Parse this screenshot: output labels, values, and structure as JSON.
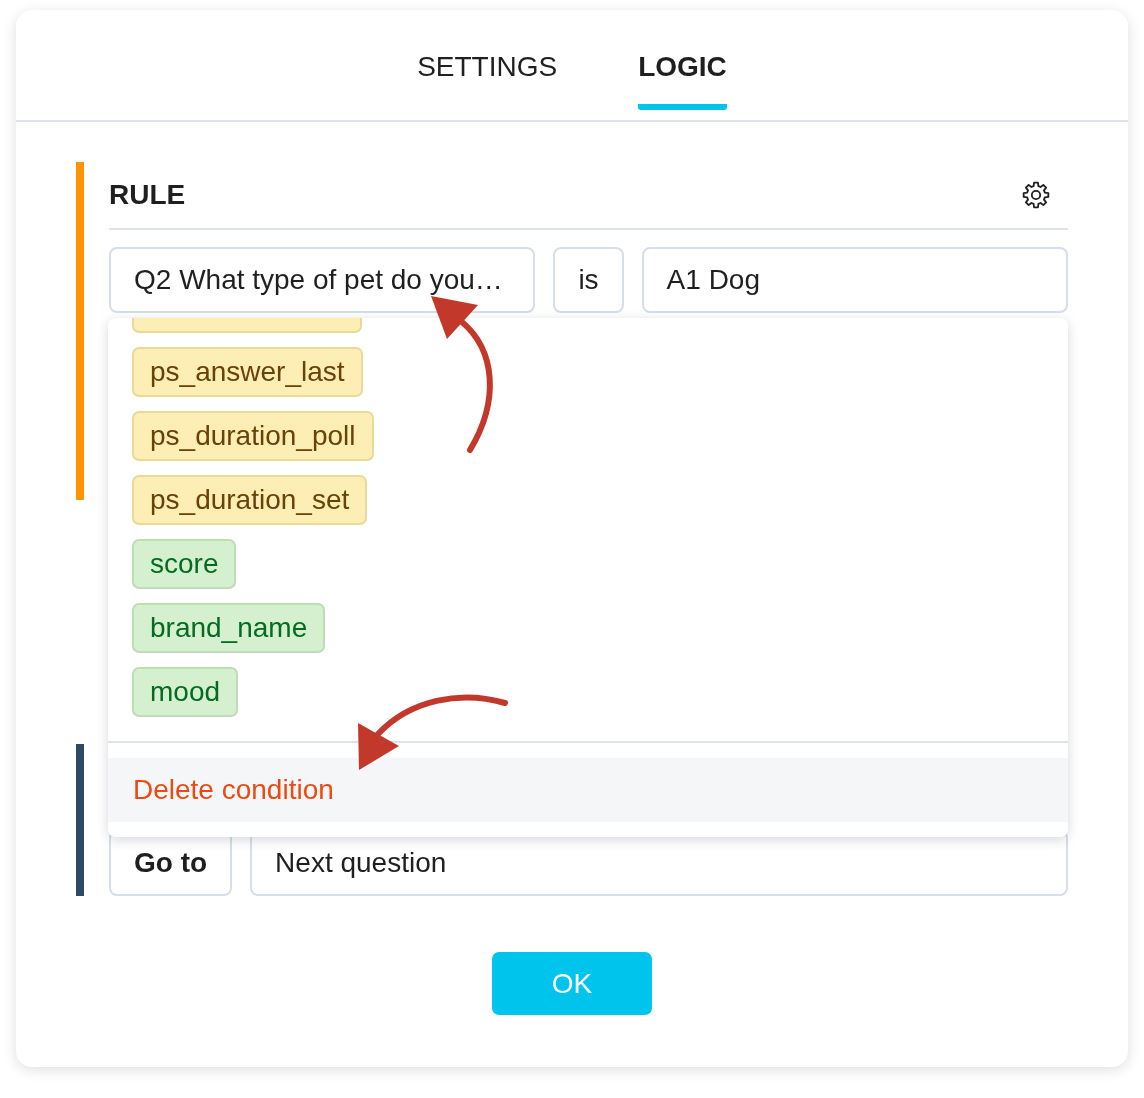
{
  "tabs": [
    {
      "label": "SETTINGS",
      "selected": false
    },
    {
      "label": "LOGIC",
      "selected": true
    }
  ],
  "rule": {
    "title": "RULE",
    "condition": {
      "question": "Q2 What type of pet do you…",
      "operator": "is",
      "answer": "A1 Dog"
    }
  },
  "dropdown": {
    "options": [
      {
        "color": "#fdeeb5"
      },
      {
        "label": "ps_answer_last",
        "color": "#fdeeb5"
      },
      {
        "label": "ps_duration_poll",
        "color": "#fdeeb5"
      },
      {
        "label": "ps_duration_set",
        "color": "#fdeeb5"
      },
      {
        "label": "score",
        "color": "#d4f0cf"
      },
      {
        "label": "brand_name",
        "color": "#d4f0cf"
      },
      {
        "label": "mood",
        "color": "#d4f0cf"
      }
    ],
    "delete_label": "Delete condition"
  },
  "action": {
    "type": "Go to",
    "target": "Next question"
  },
  "ok_button": "OK"
}
